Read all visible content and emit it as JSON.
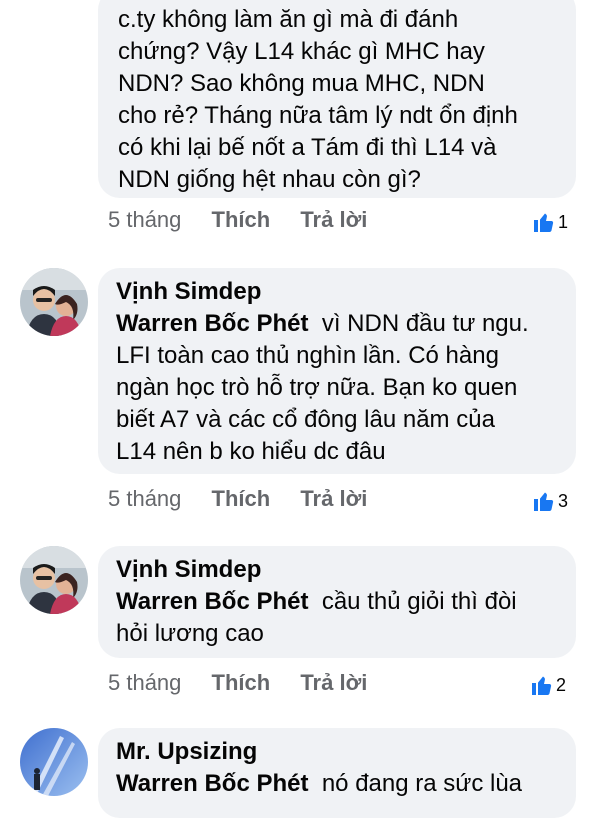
{
  "comments": [
    {
      "id": "c0",
      "text_lines": [
        "c.ty không làm ăn gì mà đi đánh",
        "chứng? Vậy L14 khác gì MHC hay",
        "NDN? Sao không mua MHC, NDN",
        "cho rẻ? Tháng nữa tâm lý ndt ổn định",
        "có khi lại bế nốt a Tám đi thì L14 và",
        "NDN giống hệt nhau còn gì?"
      ],
      "time": "5 tháng",
      "like_label": "Thích",
      "reply_label": "Trả lời",
      "likes": "1"
    },
    {
      "id": "c1",
      "author": "Vịnh Simdep",
      "mention": "Warren Bốc Phét",
      "text_lines": [
        "vì NDN đầu tư ngu.",
        "LFI toàn cao thủ nghìn lần. Có hàng",
        "ngàn học trò hỗ trợ nữa. Bạn ko quen",
        "biết A7 và các cổ đông lâu năm của",
        "L14 nên b ko hiểu dc đâu"
      ],
      "time": "5 tháng",
      "like_label": "Thích",
      "reply_label": "Trả lời",
      "likes": "3"
    },
    {
      "id": "c2",
      "author": "Vịnh Simdep",
      "mention": "Warren Bốc Phét",
      "text_lines": [
        "cầu thủ giỏi thì đòi",
        "hỏi lương cao"
      ],
      "time": "5 tháng",
      "like_label": "Thích",
      "reply_label": "Trả lời",
      "likes": "2"
    },
    {
      "id": "c3",
      "author": "Mr. Upsizing",
      "mention": "Warren Bốc Phét",
      "text_lines": [
        "nó đang ra sức lùa"
      ]
    }
  ],
  "colors": {
    "bubble": "#f0f2f5",
    "meta_text": "#65676b",
    "like_blue": "#1877f2"
  },
  "icons": {
    "like": "thumbs-up-icon"
  }
}
